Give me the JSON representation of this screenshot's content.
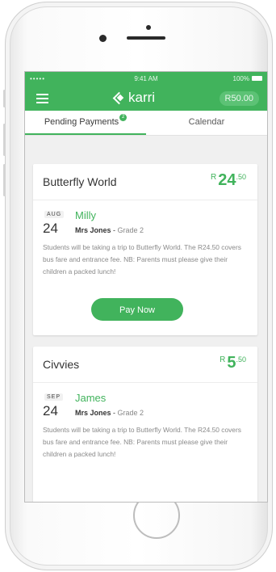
{
  "statusbar": {
    "signal": "•••••",
    "time": "9:41 AM",
    "battery": "100%"
  },
  "app": {
    "name": "karri",
    "balance": "R50.00"
  },
  "tabs": [
    {
      "label": "Pending Payments",
      "badge": "2"
    },
    {
      "label": "Calendar"
    }
  ],
  "payments": [
    {
      "title": "Butterfly World",
      "amount_currency": "R",
      "amount_whole": "24",
      "amount_cents": ".50",
      "date_month": "AUG",
      "date_day": "24",
      "child": "Milly",
      "teacher": "Mrs Jones",
      "grade": "Grade 2",
      "description": "Students will be taking a trip to Butterfly World. The R24.50 covers bus fare and entrance fee. NB: Parents must please give their children a packed lunch!",
      "button": "Pay Now"
    },
    {
      "title": "Civvies",
      "amount_currency": "R",
      "amount_whole": "5",
      "amount_cents": ".50",
      "date_month": "SEP",
      "date_day": "24",
      "child": "James",
      "teacher": "Mrs Jones",
      "grade": "Grade 2",
      "description": "Students will be taking a trip to Butterfly World. The R24.50 covers bus fare and entrance fee. NB: Parents must please give their children a packed lunch!"
    }
  ],
  "colors": {
    "brand": "#41b35c",
    "text": "#333333",
    "muted": "#8a8a8a"
  }
}
